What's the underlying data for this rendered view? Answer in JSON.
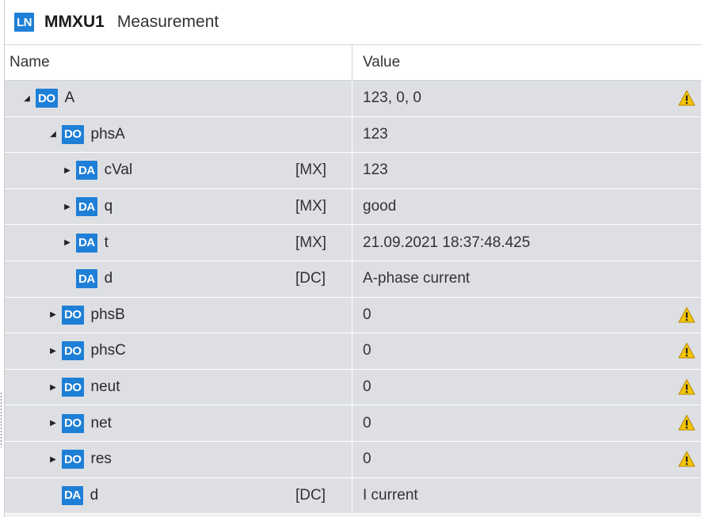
{
  "titlebar": {
    "badge": "LN",
    "name": "MMXU1",
    "description": "Measurement"
  },
  "columns": {
    "name": "Name",
    "value": "Value"
  },
  "rows": [
    {
      "indent": 0,
      "expander": "expanded",
      "type": "DO",
      "label": "A",
      "fc": "",
      "value": "123, 0, 0",
      "warning": true
    },
    {
      "indent": 1,
      "expander": "expanded",
      "type": "DO",
      "label": "phsA",
      "fc": "",
      "value": "123",
      "warning": false
    },
    {
      "indent": 2,
      "expander": "collapsed",
      "type": "DA",
      "label": "cVal",
      "fc": "[MX]",
      "value": "123",
      "warning": false
    },
    {
      "indent": 2,
      "expander": "collapsed",
      "type": "DA",
      "label": "q",
      "fc": "[MX]",
      "value": "good",
      "warning": false
    },
    {
      "indent": 2,
      "expander": "collapsed",
      "type": "DA",
      "label": "t",
      "fc": "[MX]",
      "value": "21.09.2021 18:37:48.425",
      "warning": false
    },
    {
      "indent": 2,
      "expander": "none",
      "type": "DA",
      "label": "d",
      "fc": "[DC]",
      "value": "A-phase current",
      "warning": false
    },
    {
      "indent": 1,
      "expander": "collapsed",
      "type": "DO",
      "label": "phsB",
      "fc": "",
      "value": "0",
      "warning": true
    },
    {
      "indent": 1,
      "expander": "collapsed",
      "type": "DO",
      "label": "phsC",
      "fc": "",
      "value": "0",
      "warning": true
    },
    {
      "indent": 1,
      "expander": "collapsed",
      "type": "DO",
      "label": "neut",
      "fc": "",
      "value": "0",
      "warning": true
    },
    {
      "indent": 1,
      "expander": "collapsed",
      "type": "DO",
      "label": "net",
      "fc": "",
      "value": "0",
      "warning": true
    },
    {
      "indent": 1,
      "expander": "collapsed",
      "type": "DO",
      "label": "res",
      "fc": "",
      "value": "0",
      "warning": true
    },
    {
      "indent": 1,
      "expander": "none",
      "type": "DA",
      "label": "d",
      "fc": "[DC]",
      "value": "I current",
      "warning": false
    }
  ],
  "icons": {
    "expanded": "triangle-down-icon",
    "collapsed": "triangle-right-icon",
    "warning": "warning-triangle-icon"
  },
  "colors": {
    "badge": "#1e7fd7",
    "row": "#dddfe3",
    "warning": "#f5c400"
  }
}
